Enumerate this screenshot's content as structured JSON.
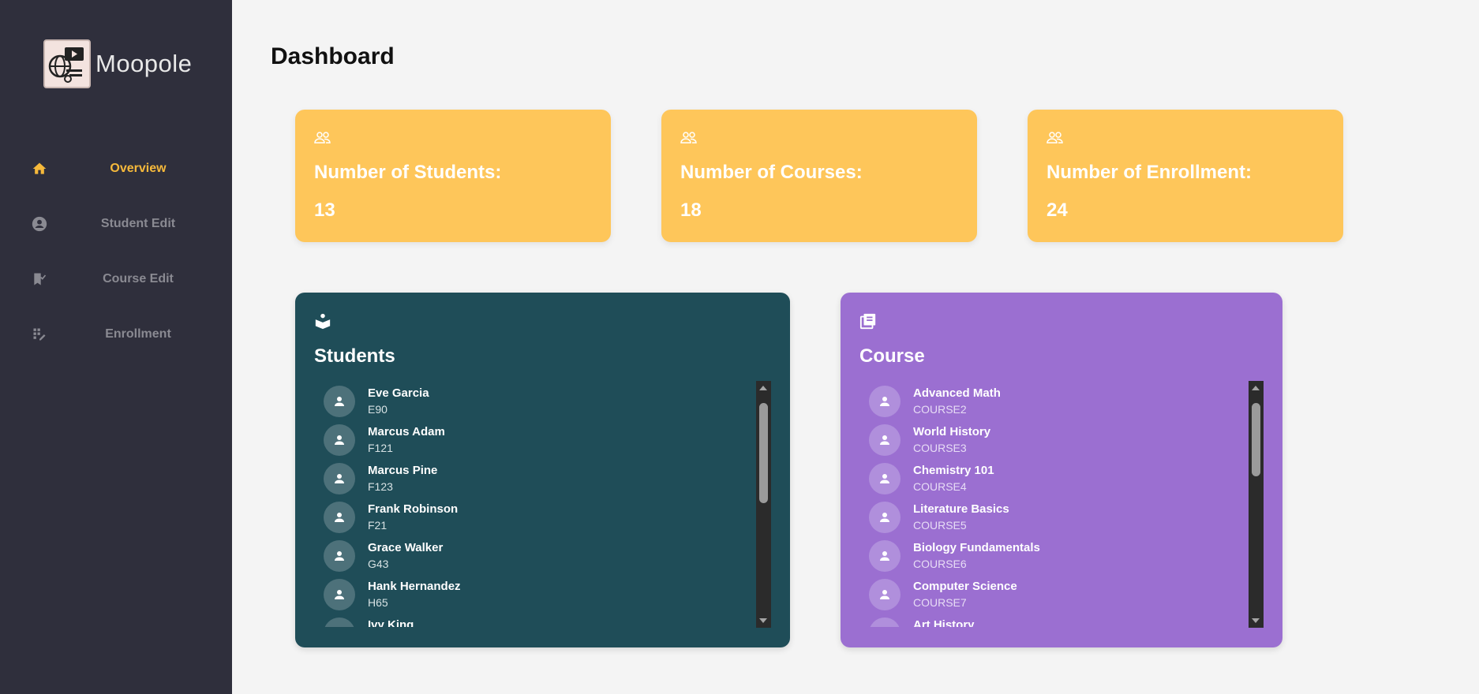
{
  "app": {
    "name": "Moopole"
  },
  "sidebar": {
    "items": [
      {
        "label": "Overview",
        "icon": "home-icon",
        "active": true
      },
      {
        "label": "Student Edit",
        "icon": "account-circle-icon",
        "active": false
      },
      {
        "label": "Course Edit",
        "icon": "bookmark-check-icon",
        "active": false
      },
      {
        "label": "Enrollment",
        "icon": "edit-grid-icon",
        "active": false
      }
    ]
  },
  "page": {
    "title": "Dashboard"
  },
  "stats": [
    {
      "label": "Number of Students:",
      "value": "13",
      "icon": "group-icon"
    },
    {
      "label": "Number of Courses:",
      "value": "18",
      "icon": "group-icon"
    },
    {
      "label": "Number of Enrollment:",
      "value": "24",
      "icon": "group-icon"
    }
  ],
  "students_panel": {
    "title": "Students",
    "icon": "reading-person-icon",
    "items": [
      {
        "name": "Eve Garcia",
        "id": "E90"
      },
      {
        "name": "Marcus Adam",
        "id": "F121"
      },
      {
        "name": "Marcus Pine",
        "id": "F123"
      },
      {
        "name": "Frank Robinson",
        "id": "F21"
      },
      {
        "name": "Grace Walker",
        "id": "G43"
      },
      {
        "name": "Hank Hernandez",
        "id": "H65"
      },
      {
        "name": "Ivy King",
        "id": ""
      }
    ]
  },
  "courses_panel": {
    "title": "Course",
    "icon": "library-books-icon",
    "items": [
      {
        "name": "Advanced Math",
        "id": "COURSE2"
      },
      {
        "name": "World History",
        "id": "COURSE3"
      },
      {
        "name": "Chemistry 101",
        "id": "COURSE4"
      },
      {
        "name": "Literature Basics",
        "id": "COURSE5"
      },
      {
        "name": "Biology Fundamentals",
        "id": "COURSE6"
      },
      {
        "name": "Computer Science",
        "id": "COURSE7"
      },
      {
        "name": "Art History",
        "id": ""
      }
    ]
  },
  "colors": {
    "sidebar_bg": "#2f2f3c",
    "accent": "#f6b93b",
    "stat_card": "#fec65a",
    "students_panel": "#1f4d58",
    "courses_panel": "#9b6fd1"
  }
}
